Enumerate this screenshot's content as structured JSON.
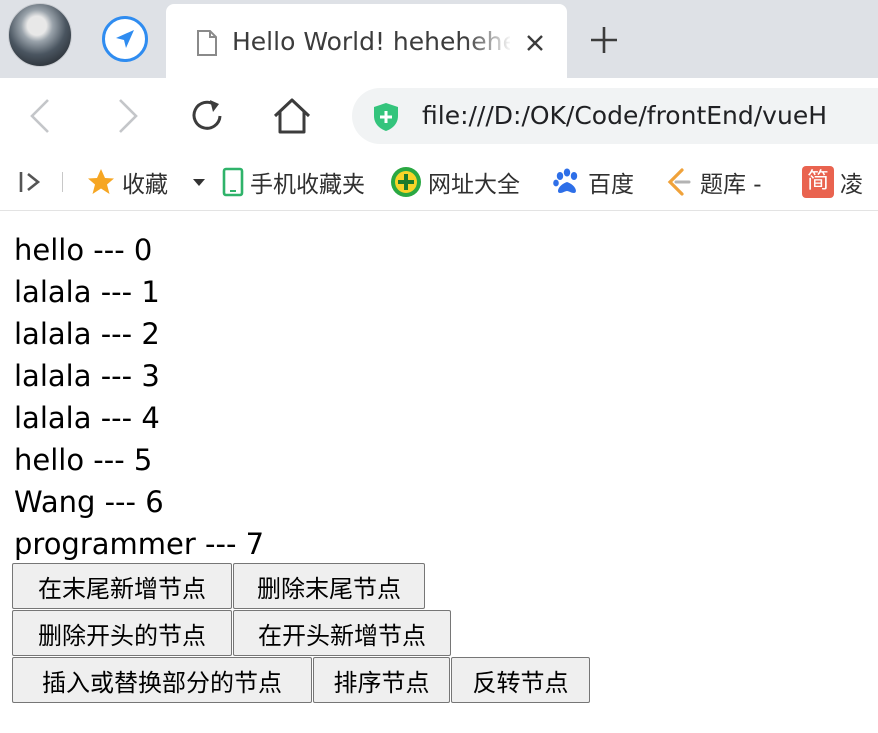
{
  "browser": {
    "tab": {
      "title": "Hello World! hehehehehe"
    },
    "address_bar": {
      "url": "file:///D:/OK/Code/frontEnd/vueH"
    },
    "bookmarks": [
      {
        "label": "收藏",
        "icon": "star-icon"
      },
      {
        "label": "手机收藏夹",
        "icon": "mobile-icon"
      },
      {
        "label": "网址大全",
        "icon": "plus-circle-icon"
      },
      {
        "label": "百度",
        "icon": "baidu-paw-icon"
      },
      {
        "label": "题库 -",
        "icon": "leetcode-icon"
      },
      {
        "label": "凌",
        "icon": "jian-icon"
      }
    ],
    "bookmark_icon_chars": {
      "jian": "简"
    }
  },
  "page": {
    "items": [
      {
        "text": "hello --- 0"
      },
      {
        "text": "lalala --- 1"
      },
      {
        "text": "lalala --- 2"
      },
      {
        "text": "lalala --- 3"
      },
      {
        "text": "lalala --- 4"
      },
      {
        "text": "hello --- 5"
      },
      {
        "text": "Wang --- 6"
      },
      {
        "text": "programmer --- 7"
      }
    ],
    "buttons": {
      "add_tail": "在末尾新增节点",
      "remove_tail": "删除末尾节点",
      "remove_head": "删除开头的节点",
      "add_head": "在开头新增节点",
      "insert_replace": "插入或替换部分的节点",
      "sort": "排序节点",
      "reverse": "反转节点"
    }
  },
  "colors": {
    "accent": "#2f8cf0",
    "secure": "#34c47c",
    "tabstrip": "#dee1e6"
  }
}
